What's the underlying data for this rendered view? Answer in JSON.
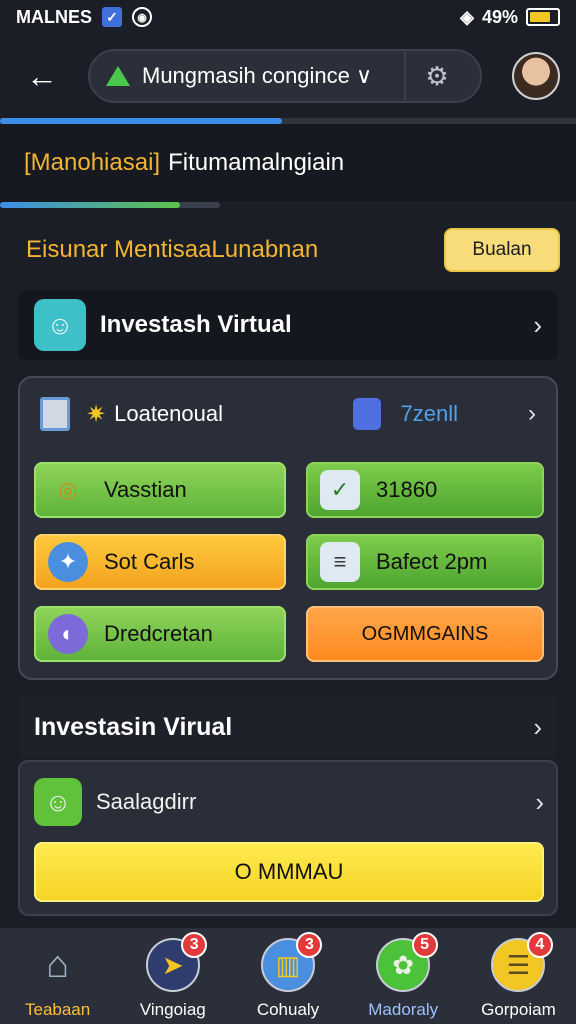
{
  "status_bar": {
    "carrier": "MALNES",
    "battery_text": "49%",
    "battery_level": 0.75,
    "icons": [
      "check-box-icon",
      "circle-icon",
      "wifi-icon",
      "battery-icon"
    ]
  },
  "top_bar": {
    "search_text": "Mungmasih congince ∨",
    "icons": [
      "back-arrow-icon",
      "warning-icon",
      "gear-icon",
      "avatar"
    ]
  },
  "progress": {
    "top_fill": 0.49,
    "mid_fill": 0.82
  },
  "section_header": {
    "accent": "[Manohiasai]",
    "text": "Fitumamalngiain"
  },
  "hero": {
    "title": "Eisunar MentisaaLunabnan",
    "button_label": "Bualan"
  },
  "row1": {
    "title": "Investash Virtual",
    "icon": "person-avatar-icon"
  },
  "grid": {
    "header_label": "Loatenoual",
    "header_value": "7zenll",
    "tiles": [
      {
        "label": "Vasstian",
        "icon": "coins-icon",
        "color": "green"
      },
      {
        "label": "31860",
        "icon": "chart-check-icon",
        "color": "green"
      },
      {
        "label": "Sot Carls",
        "icon": "compass-icon",
        "color": "orange"
      },
      {
        "label": "Bafect 2pm",
        "icon": "document-icon",
        "color": "green"
      },
      {
        "label": "Dredcretan",
        "icon": "swirl-icon",
        "color": "green"
      },
      {
        "label": "OGMMGAINS",
        "icon": "",
        "color": "orange-button"
      }
    ]
  },
  "section2": {
    "title": "Investasin Virual"
  },
  "bottom_card": {
    "label": "Saalagdirr",
    "button_label": "O MMMAU"
  },
  "tab_bar": {
    "tabs": [
      {
        "label": "Teabaan",
        "icon": "home-icon",
        "badge": "",
        "active": true
      },
      {
        "label": "Vingoiag",
        "icon": "send-icon",
        "badge": "3",
        "active": false
      },
      {
        "label": "Cohualy",
        "icon": "chart-icon",
        "badge": "3",
        "active": false
      },
      {
        "label": "Madoraly",
        "icon": "chat-icon",
        "badge": "5",
        "active": false
      },
      {
        "label": "Gorpoiam",
        "icon": "stack-icon",
        "badge": "4",
        "active": false
      }
    ]
  },
  "colors": {
    "accent_yellow": "#f2b531",
    "primary_blue": "#3b8fe8",
    "green": "#5fb33a",
    "orange": "#f3a31f",
    "badge_red": "#e23a3a"
  }
}
